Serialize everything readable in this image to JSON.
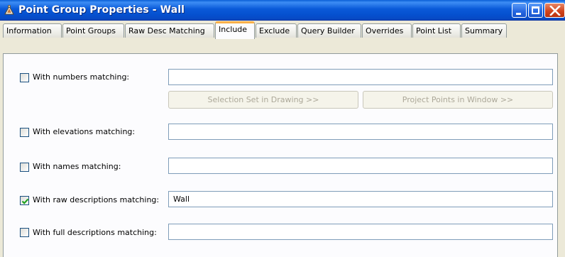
{
  "window": {
    "title": "Point Group Properties - Wall",
    "icon": "survey-point-group-icon",
    "controls": [
      "minimize-icon",
      "maximize-icon",
      "close-icon"
    ]
  },
  "tabs": [
    {
      "label": "Information",
      "active": false
    },
    {
      "label": "Point Groups",
      "active": false
    },
    {
      "label": "Raw Desc Matching",
      "active": false
    },
    {
      "label": "Include",
      "active": true
    },
    {
      "label": "Exclude",
      "active": false
    },
    {
      "label": "Query Builder",
      "active": false
    },
    {
      "label": "Overrides",
      "active": false
    },
    {
      "label": "Point List",
      "active": false
    },
    {
      "label": "Summary",
      "active": false
    }
  ],
  "include": {
    "numbers": {
      "label": "With numbers matching:",
      "checked": false,
      "value": ""
    },
    "selection_set_button": "Selection Set in Drawing >>",
    "project_points_button": "Project Points in Window >>",
    "elevations": {
      "label": "With elevations matching:",
      "checked": false,
      "value": ""
    },
    "names": {
      "label": "With names matching:",
      "checked": false,
      "value": ""
    },
    "raw_descriptions": {
      "label": "With raw descriptions matching:",
      "checked": true,
      "value": "Wall"
    },
    "full_descriptions": {
      "label": "With full descriptions matching:",
      "checked": false,
      "value": ""
    }
  },
  "colors": {
    "titlebar": "#0a5ad8",
    "active_tab_highlight": "#f9b04a",
    "checkmark": "#21a121",
    "disabled_text": "#aca899"
  }
}
